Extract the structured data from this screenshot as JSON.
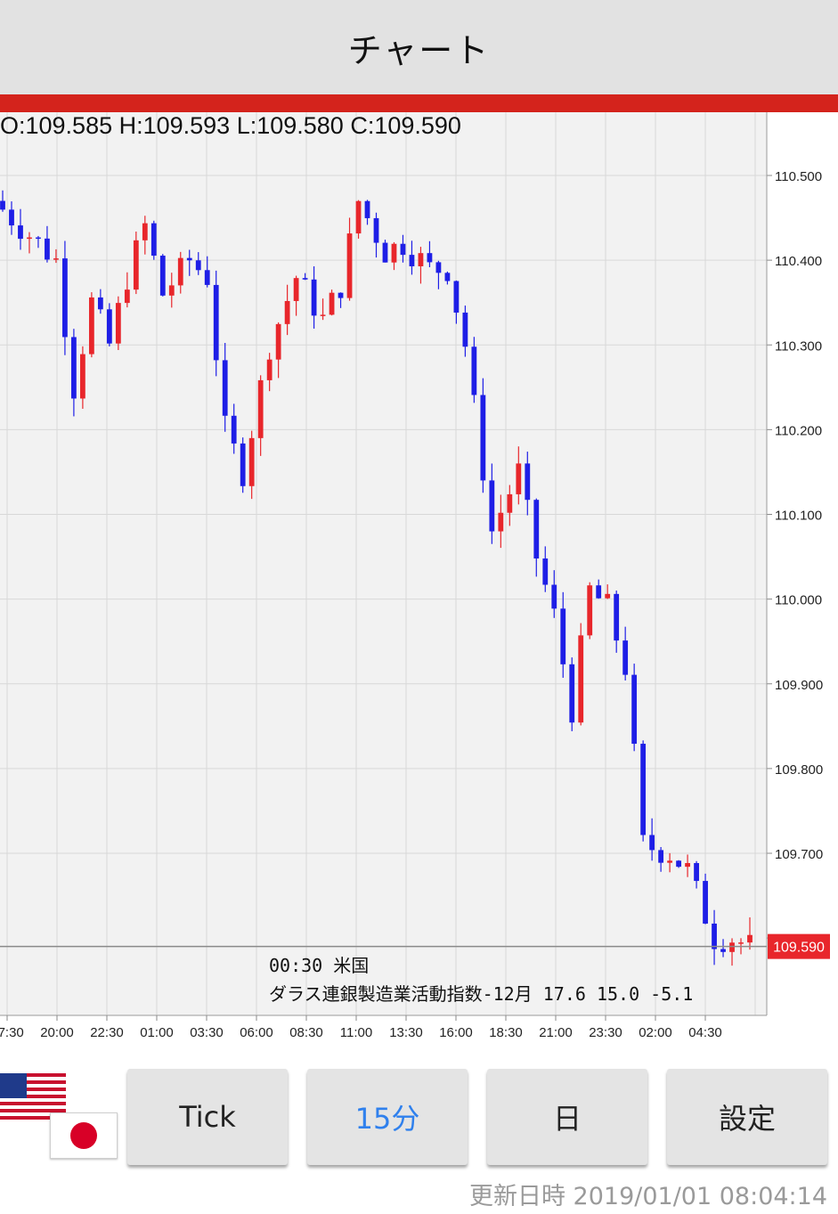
{
  "header": {
    "title": "チャート"
  },
  "ohlc": {
    "text": "O:109.585 H:109.593 L:109.580 C:109.590"
  },
  "price_axis": {
    "ticks": [
      "110.500",
      "110.400",
      "110.300",
      "110.200",
      "110.100",
      "110.000",
      "109.900",
      "109.800",
      "109.700"
    ],
    "current_price": "109.590"
  },
  "time_axis": {
    "ticks": [
      "17:30",
      "20:00",
      "22:30",
      "01:00",
      "03:30",
      "06:00",
      "08:30",
      "11:00",
      "13:30",
      "16:00",
      "18:30",
      "21:00",
      "23:30",
      "02:00",
      "04:30"
    ]
  },
  "event": {
    "line1": "00:30 米国",
    "line2": "ダラス連銀製造業活動指数-12月 17.6 15.0 -5.1"
  },
  "buttons": {
    "tick": "Tick",
    "m15": "15分",
    "day": "日",
    "settings": "設定"
  },
  "footer": {
    "updated": "更新日時 2019/01/01 08:04:14"
  },
  "colors": {
    "up": "#e8262b",
    "down": "#1e1ee6",
    "header_bar": "#d4231c",
    "active_button": "#2f80ed"
  },
  "chart_data": {
    "type": "candlestick",
    "title": "",
    "ylim": [
      109.54,
      110.57
    ],
    "y_ticks": [
      110.5,
      110.4,
      110.3,
      110.2,
      110.1,
      110.0,
      109.9,
      109.8,
      109.7
    ],
    "current_price": 109.59,
    "interval": "15分",
    "close_path": [
      [
        0,
        110.46
      ],
      [
        6,
        110.4
      ],
      [
        8,
        110.25
      ],
      [
        10,
        110.35
      ],
      [
        12,
        110.3
      ],
      [
        14,
        110.38
      ],
      [
        16,
        110.44
      ],
      [
        18,
        110.36
      ],
      [
        21,
        110.4
      ],
      [
        23,
        110.38
      ],
      [
        25,
        110.2
      ],
      [
        27,
        110.15
      ],
      [
        30,
        110.3
      ],
      [
        33,
        110.38
      ],
      [
        36,
        110.33
      ],
      [
        38,
        110.37
      ],
      [
        40,
        110.47
      ],
      [
        43,
        110.41
      ],
      [
        45,
        110.42
      ],
      [
        48,
        110.39
      ],
      [
        50,
        110.39
      ],
      [
        52,
        110.3
      ],
      [
        55,
        110.08
      ],
      [
        58,
        110.15
      ],
      [
        60,
        110.05
      ],
      [
        62,
        109.98
      ],
      [
        64,
        109.87
      ],
      [
        66,
        110.01
      ],
      [
        68,
        109.99
      ],
      [
        70,
        109.92
      ],
      [
        72,
        109.71
      ],
      [
        75,
        109.7
      ],
      [
        77,
        109.68
      ],
      [
        80,
        109.6
      ],
      [
        82,
        109.6
      ],
      [
        84,
        109.59
      ]
    ]
  }
}
